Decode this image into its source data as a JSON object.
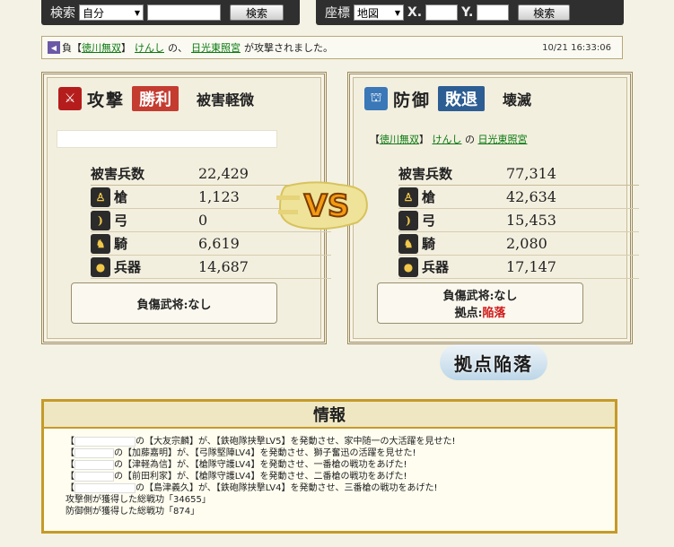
{
  "search": {
    "label": "検索",
    "scope": "自分",
    "query": "",
    "button": "検索"
  },
  "coords": {
    "label": "座標",
    "scope": "地図",
    "x_label": "X.",
    "y_label": "Y.",
    "x": "",
    "y": "",
    "button": "検索"
  },
  "notice": {
    "icon_glyph": "◀",
    "result": "負",
    "prefix": "【",
    "alliance": "徳川無双",
    "sep": "】",
    "player": "けんし",
    "mid": "の、",
    "base": "日光東照宮",
    "suffix": "が攻撃されました。",
    "time": "10/21 16:33:06"
  },
  "attack": {
    "title": "攻撃",
    "result": "勝利",
    "damage_level": "被害軽微",
    "stats": {
      "total_label": "被害兵数",
      "total": "22,429",
      "units": [
        {
          "label": "槍",
          "value": "1,123",
          "icon": "spear-icon"
        },
        {
          "label": "弓",
          "value": "0",
          "icon": "bow-icon"
        },
        {
          "label": "騎",
          "value": "6,619",
          "icon": "horse-icon"
        },
        {
          "label": "兵器",
          "value": "14,687",
          "icon": "siege-icon"
        }
      ]
    },
    "injured": "負傷武将:なし"
  },
  "defense": {
    "title": "防御",
    "result": "敗退",
    "damage_level": "壊滅",
    "owner": {
      "prefix": "【",
      "alliance": "徳川無双",
      "sep": "】",
      "player": "けんし",
      "mid": "の",
      "base": "日光東照宮"
    },
    "stats": {
      "total_label": "被害兵数",
      "total": "77,314",
      "units": [
        {
          "label": "槍",
          "value": "42,634",
          "icon": "spear-icon"
        },
        {
          "label": "弓",
          "value": "15,453",
          "icon": "bow-icon"
        },
        {
          "label": "騎",
          "value": "2,080",
          "icon": "horse-icon"
        },
        {
          "label": "兵器",
          "value": "17,147",
          "icon": "siege-icon"
        }
      ]
    },
    "injured": "負傷武将:なし",
    "base_label": "拠点:",
    "base_status": "陥落"
  },
  "vs_text": "VS",
  "fallen_banner": "拠点陥落",
  "info": {
    "title": "情報",
    "lines": [
      {
        "pre": "【",
        "post": "の【大友宗麟】が、【鉄砲隊挟撃LV5】を発動させ、家中随一の大活躍を見せた!"
      },
      {
        "pre": "【",
        "post": "の【加藤嘉明】が、【弓隊堅陣LV4】を発動させ、獅子奮迅の活躍を見せた!"
      },
      {
        "pre": "【",
        "post": "の【津軽為信】が、【槍隊守護LV4】を発動させ、一番槍の戦功をあげた!"
      },
      {
        "pre": "【",
        "post": "の【前田利家】が、【槍隊守護LV4】を発動させ、二番槍の戦功をあげた!"
      },
      {
        "pre": "【",
        "post": "の【島津義久】が、【鉄砲隊挟撃LV4】を発動させ、三番槍の戦功をあげた!"
      }
    ],
    "attacker_score": "攻撃側が獲得した総戦功「34655」",
    "defender_score": "防御側が獲得した総戦功「874」"
  }
}
